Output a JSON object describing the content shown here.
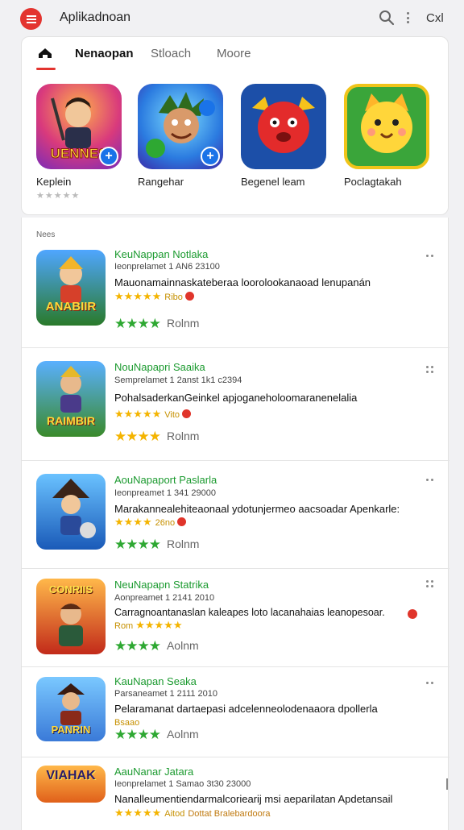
{
  "header": {
    "title": "Aplikadnoan",
    "account_text": "Cxl",
    "accent_color": "#e3342f"
  },
  "tabs": [
    {
      "label": "Nenaopan",
      "active": true
    },
    {
      "label": "Stloach",
      "active": false
    },
    {
      "label": "Moore",
      "active": false
    }
  ],
  "featured": [
    {
      "label": "Keplein",
      "icon": "hero-game-icon",
      "stars": "★★★★★"
    },
    {
      "label": "Rangehar",
      "icon": "runner-game-icon",
      "stars": ""
    },
    {
      "label": "Begenel leam",
      "icon": "red-blob-game-icon",
      "stars": ""
    },
    {
      "label": "Poclagtakah",
      "icon": "yellow-cat-game-icon",
      "stars": ""
    }
  ],
  "section_label": "Nees",
  "apps": [
    {
      "title": "KeuNappan Notlaka",
      "meta": "Ieonprelamet 1 AN6 23100",
      "desc": "Mauonamainnaskateberaa loorolookanaoad lenupanán",
      "stars_small": "★★★★★",
      "small_text": "Ribo",
      "stars_big": "★★★★",
      "rating_label": "Rolnm",
      "icon_text": "ANABIIR"
    },
    {
      "title": "NouNapapri Saaika",
      "meta": "Semprelamet 1 2anst 1k1 c2394",
      "desc": "PohalsaderkanGeinkel apjoganeholoomaranenelalia",
      "stars_small": "★★★★★",
      "small_text": "Vito",
      "stars_big": "★★★★",
      "rating_label": "Rolnm",
      "icon_text": "RAIMBIR"
    },
    {
      "title": "AouNapaport Paslarla",
      "meta": "Ieonpreamet 1 341 29000",
      "desc": "Marakannealehiteaonaal ydotunjermeo aacsoadar Apenkarle:",
      "stars_small": "★★★★",
      "small_text": "26no",
      "stars_big": "★★★★",
      "rating_label": "Rolnm",
      "icon_text": ""
    },
    {
      "title": "NeuNapapn Statrika",
      "meta": "Aonpreamet 1 2141 2010",
      "desc": "Carragnoantanaslan kaleapes loto lacanahaias leanopesoar.",
      "stars_small": "★★★★★",
      "small_text": "Rom",
      "stars_big": "★★★★",
      "rating_label": "Aolnm",
      "icon_text": "CONRIIS"
    },
    {
      "title": "KauNapan Seaka",
      "meta": "Parsaneamet 1 2111 2010",
      "desc": "Pelaramanat dartaepasi adcelenneolodenaaora dpollerla",
      "stars_small": "",
      "small_text": "Bsaao",
      "stars_big": "★★★★",
      "rating_label": "Aolnm",
      "icon_text": "PANRIN"
    },
    {
      "title": "AauNanar Jatara",
      "meta": "Ieonprelamet 1 Samao 3t30 23000",
      "desc": "Nanalleumentiendarmalcoriearij msi aeparilatan Apdetansail",
      "stars_small": "★★★★★",
      "small_text": "Aitod",
      "extra_text": "Dottat Bralebardoora",
      "stars_big": "",
      "rating_label": "",
      "icon_text": "VIAHAK"
    }
  ],
  "colors": {
    "title_green": "#1b9a2f",
    "star_green": "#2ea832",
    "star_yellow": "#f4b400"
  }
}
